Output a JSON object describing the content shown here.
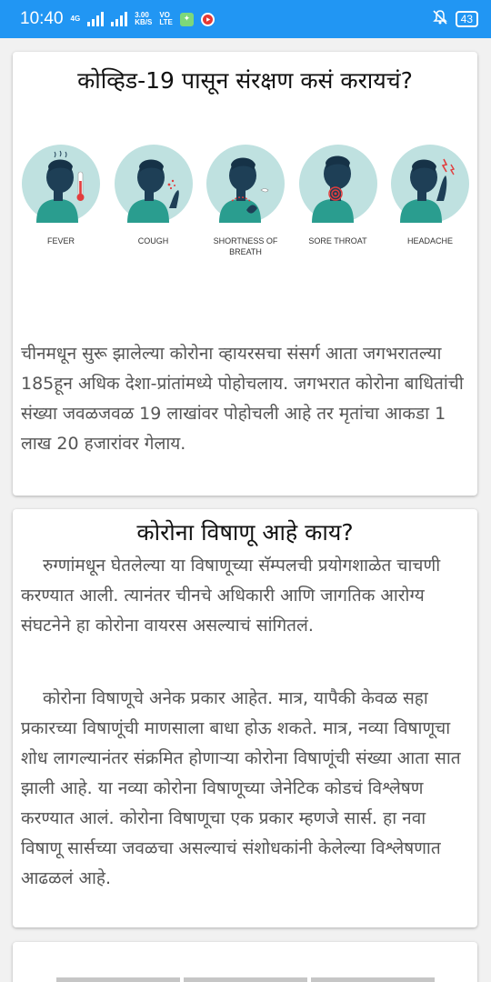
{
  "status_bar": {
    "time": "10:40",
    "network_type": "4G",
    "speed_value": "3.00",
    "speed_unit": "KB/S",
    "volte_top": "VO",
    "volte_bottom": "LTE",
    "battery": "43",
    "color": "#2196f3"
  },
  "card1": {
    "title": "कोव्हिड-19 पासून संरक्षण कसं करायचं?",
    "symptoms": [
      {
        "label": "FEVER",
        "icon": "fever-icon"
      },
      {
        "label": "COUGH",
        "icon": "cough-icon"
      },
      {
        "label": "SHORTNESS OF BREATH",
        "icon": "shortness-of-breath-icon"
      },
      {
        "label": "SORE THROAT",
        "icon": "sore-throat-icon"
      },
      {
        "label": "HEADACHE",
        "icon": "headache-icon"
      }
    ],
    "paragraph": "चीनमधून सुरू झालेल्या कोरोना व्हायरसचा संसर्ग आता जगभरातल्या 185हून अधिक देशा-प्रांतांमध्ये पोहोचलाय. जगभरात कोरोना बाधितांची संख्या जवळजवळ 19 लाखांवर पोहोचली आहे तर मृतांचा आकडा 1 लाख 20 हजारांवर गेलाय."
  },
  "card2": {
    "title": "कोरोना विषाणू आहे काय?",
    "paragraph1": "रुग्णांमधून घेतलेल्या या विषाणूच्या सॅम्पलची प्रयोगशाळेत चाचणी करण्यात आली. त्यानंतर चीनचे अधिकारी आणि जागतिक आरोग्य संघटनेने हा कोरोना वायरस असल्याचं सांगितलं.",
    "paragraph2": "कोरोना विषाणूचे अनेक प्रकार आहेत. मात्र, यापैकी केवळ सहा प्रकारच्या विषाणूंची माणसाला बाधा होऊ शकते. मात्र, नव्या विषाणूचा शोध लागल्यानंतर संक्रमित होणाऱ्या कोरोना विषाणूंची संख्या आता सात झाली आहे. या नव्या कोरोना विषाणूच्या जेनेटिक कोडचं विश्लेषण करण्यात आलं. कोरोना विषाणूचा एक प्रकार म्हणजे सार्स. हा नवा विषाणू सार्सच्या जवळचा असल्याचं संशोधकांनी केलेल्या विश्लेषणात आढळलं आहे."
  },
  "colors": {
    "illustration_circle": "#bfe1e0",
    "figure_skin": "#1e3f56",
    "figure_shirt": "#2a9d8f",
    "symptom_red": "#e23d3d"
  }
}
